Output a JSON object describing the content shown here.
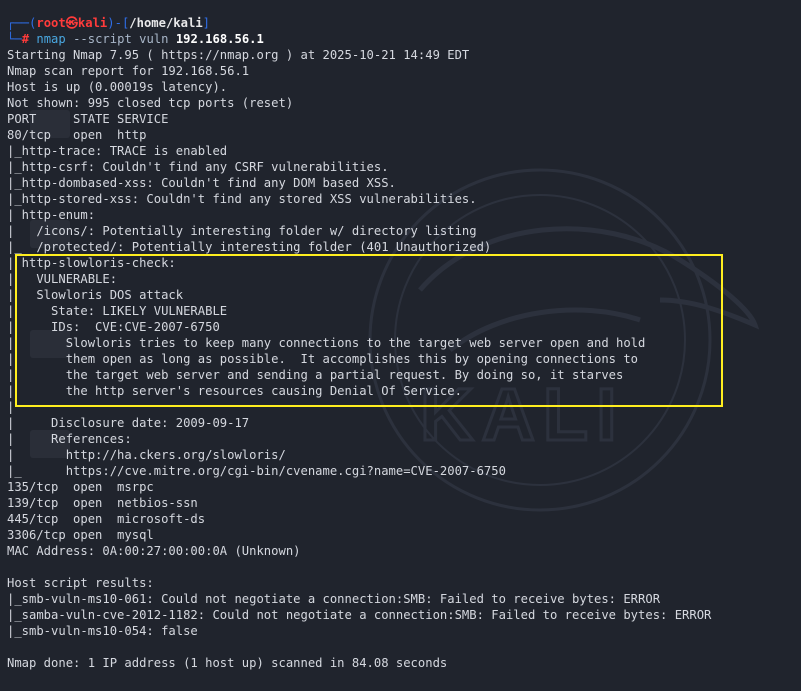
{
  "prompt": {
    "bracket_open": "┌──(",
    "user": "root",
    "at": "㉿",
    "host": "kali",
    "bracket_mid": ")-[",
    "cwd": "/home/kali",
    "bracket_close": "]",
    "line2_prefix": "└─",
    "symbol": "#",
    "command": "nmap",
    "options": "--script vuln",
    "target": "192.168.56.1"
  },
  "output": [
    "Starting Nmap 7.95 ( https://nmap.org ) at 2025-10-21 14:49 EDT",
    "Nmap scan report for 192.168.56.1",
    "Host is up (0.00019s latency).",
    "Not shown: 995 closed tcp ports (reset)",
    "PORT     STATE SERVICE",
    "80/tcp   open  http",
    "|_http-trace: TRACE is enabled",
    "|_http-csrf: Couldn't find any CSRF vulnerabilities.",
    "|_http-dombased-xss: Couldn't find any DOM based XSS.",
    "|_http-stored-xss: Couldn't find any stored XSS vulnerabilities.",
    "| http-enum:",
    "|   /icons/: Potentially interesting folder w/ directory listing",
    "|_  /protected/: Potentially interesting folder (401 Unauthorized)",
    "| http-slowloris-check:",
    "|   VULNERABLE:",
    "|   Slowloris DOS attack",
    "|     State: LIKELY VULNERABLE",
    "|     IDs:  CVE:CVE-2007-6750",
    "|       Slowloris tries to keep many connections to the target web server open and hold",
    "|       them open as long as possible.  It accomplishes this by opening connections to",
    "|       the target web server and sending a partial request. By doing so, it starves",
    "|       the http server's resources causing Denial Of Service.",
    "|",
    "|     Disclosure date: 2009-09-17",
    "|     References:",
    "|       http://ha.ckers.org/slowloris/",
    "|_      https://cve.mitre.org/cgi-bin/cvename.cgi?name=CVE-2007-6750",
    "135/tcp  open  msrpc",
    "139/tcp  open  netbios-ssn",
    "445/tcp  open  microsoft-ds",
    "3306/tcp open  mysql",
    "MAC Address: 0A:00:27:00:00:0A (Unknown)",
    "",
    "Host script results:",
    "|_smb-vuln-ms10-061: Could not negotiate a connection:SMB: Failed to receive bytes: ERROR",
    "|_samba-vuln-cve-2012-1182: Could not negotiate a connection:SMB: Failed to receive bytes: ERROR",
    "|_smb-vuln-ms10-054: false",
    "",
    "Nmap done: 1 IP address (1 host up) scanned in 84.08 seconds"
  ],
  "watermark_text": "KALI",
  "colors": {
    "background": "#20242d",
    "text": "#d5d8df",
    "prompt_blue": "#2f6ee8",
    "prompt_red": "#ff3b3b",
    "highlight": "#ffee1f"
  }
}
